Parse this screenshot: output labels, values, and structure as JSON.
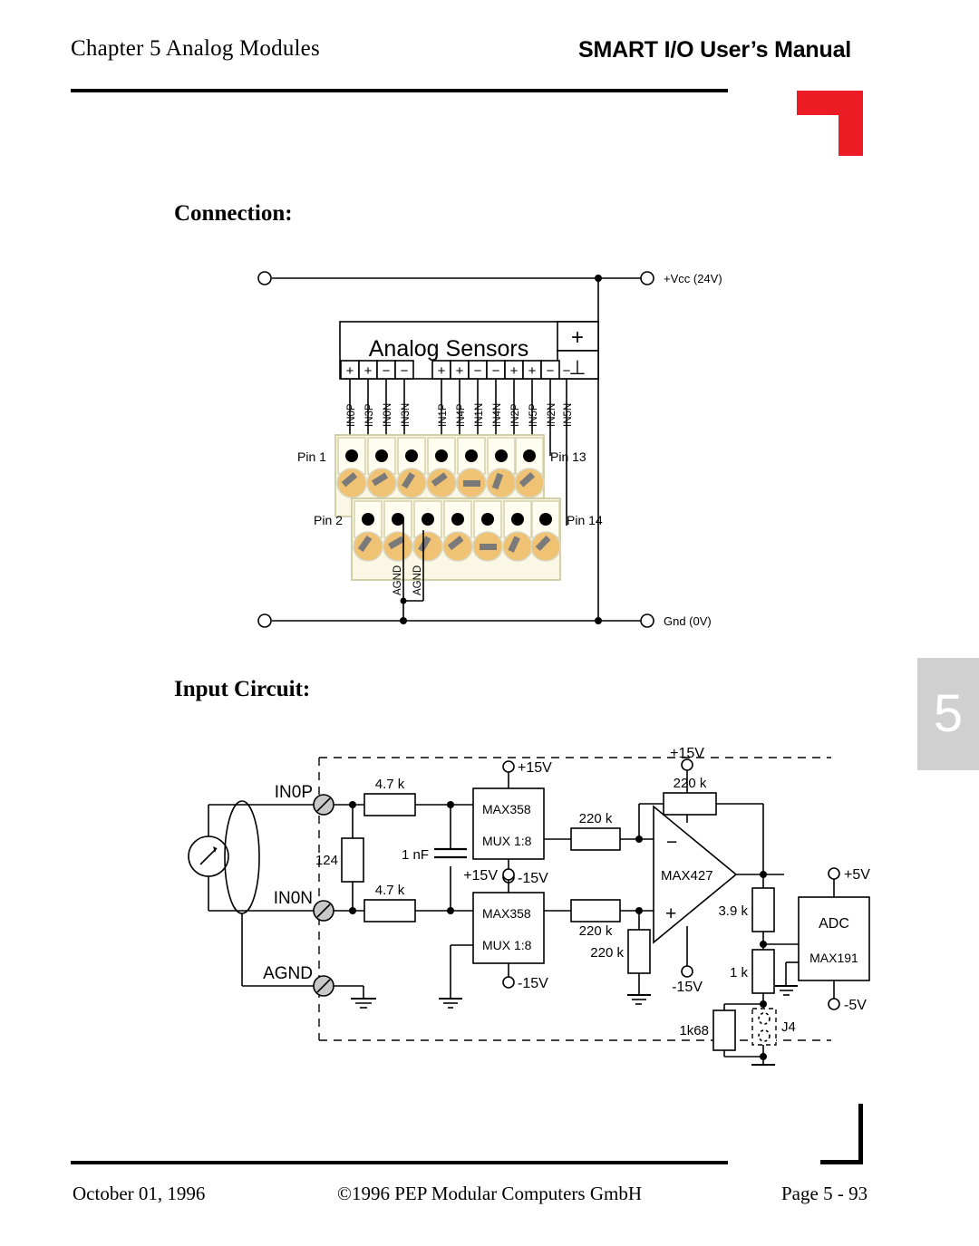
{
  "header": {
    "chapter_title": "Chapter 5  Analog Modules",
    "manual_title": "SMART I/O User’s Manual",
    "corner_mark_color": "#ED1C24"
  },
  "footer": {
    "date": "October 01, 1996",
    "copyright": "©1996 PEP Modular Computers GmbH",
    "page": "Page 5 - 93"
  },
  "chapter_thumb": {
    "number": "5",
    "background_color": "#D0D0D0",
    "text_color": "#FFFFFF"
  },
  "sections": {
    "connection_heading": "Connection:",
    "input_circuit_heading": "Input Circuit:"
  },
  "connection_diagram": {
    "supply_rail_top_label": "+Vcc (24V)",
    "supply_rail_bottom_label": "Gnd (0V)",
    "sensor_box_label": "Analog Sensors",
    "sensor_power_plus": "+",
    "sensor_power_gnd": "⊥",
    "terminal_polarity_group_a": [
      "+",
      "+",
      "−",
      "−"
    ],
    "terminal_polarity_group_b": [
      "+",
      "+",
      "−",
      "−",
      "+",
      "+",
      "−",
      "−"
    ],
    "signal_labels": [
      "IN0P",
      "IN3P",
      "IN0N",
      "IN3N",
      "IN1P",
      "IN4P",
      "IN1N",
      "IN4N",
      "IN2P",
      "IN5P",
      "IN2N",
      "IN5N"
    ],
    "ground_labels": [
      "AGND",
      "AGND"
    ],
    "pin_labels": {
      "top_left": "Pin 1",
      "top_right": "Pin 13",
      "bottom_left": "Pin 2",
      "bottom_right": "Pin 14"
    },
    "screw_color": "#F0C274",
    "screw_slot_color": "#7A7A7A",
    "block_body_color": "#FAF8E4"
  },
  "input_circuit_diagram": {
    "terminal_labels": [
      "IN0P",
      "IN0N",
      "AGND"
    ],
    "resistors": [
      {
        "id": "r-shunt",
        "value": "124"
      },
      {
        "id": "r-series-p",
        "value": "4.7 k"
      },
      {
        "id": "r-series-n",
        "value": "4.7 k"
      },
      {
        "id": "r-in-minus",
        "value": "220 k"
      },
      {
        "id": "r-in-plus",
        "value": "220 k"
      },
      {
        "id": "r-plus-gnd",
        "value": "220 k"
      },
      {
        "id": "r-feedback",
        "value": "220 k"
      },
      {
        "id": "r-out-39k",
        "value": "3.9 k"
      },
      {
        "id": "r-out-1k",
        "value": "1 k"
      },
      {
        "id": "r-1k68",
        "value": "1k68"
      }
    ],
    "capacitor": {
      "id": "c-filter",
      "value": "1 nF"
    },
    "mux_top": {
      "part": "MAX358",
      "function": "MUX  1:8"
    },
    "mux_bottom": {
      "part": "MAX358",
      "function": "MUX  1:8"
    },
    "opamp": {
      "part": "MAX427",
      "minus": "−",
      "plus": "+"
    },
    "adc": {
      "title": "ADC",
      "part": "MAX191"
    },
    "jumper": {
      "label": "J4"
    },
    "supply_labels": {
      "mux_top_pos": "+15V",
      "mux_top_neg": "-15V",
      "mux_bottom_pos": "+15V",
      "mux_bottom_neg": "-15V",
      "opamp_pos": "+15V",
      "opamp_neg": "-15V",
      "adc_pos": "+5V",
      "adc_neg": "-5V"
    }
  }
}
